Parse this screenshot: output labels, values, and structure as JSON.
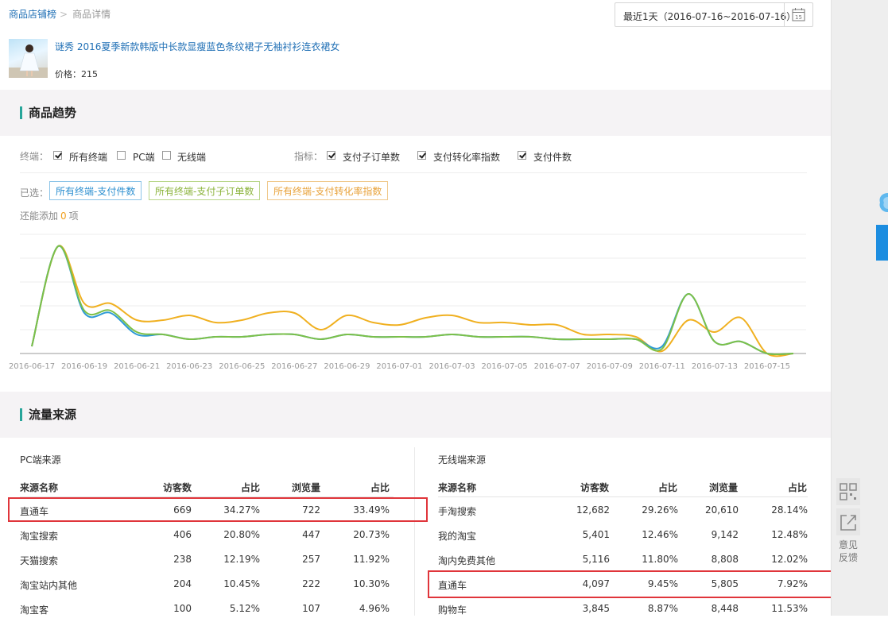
{
  "breadcrumb": {
    "root": "商品店铺榜",
    "current": "商品详情"
  },
  "date_picker": {
    "label": "最近1天（2016-07-16~2016-07-16）",
    "calendar_day": "15"
  },
  "product": {
    "title": "谜秀 2016夏季新款韩版中长款显瘦蓝色条纹裙子无袖衬衫连衣裙女",
    "price_label": "价格：215"
  },
  "trend_section": {
    "title": "商品趋势",
    "terminal_label": "终端：",
    "terminals": [
      {
        "label": "所有终端",
        "checked": true
      },
      {
        "label": "PC端",
        "checked": false
      },
      {
        "label": "无线端",
        "checked": false
      }
    ],
    "metric_label": "指标：",
    "metrics": [
      {
        "label": "支付子订单数",
        "checked": true
      },
      {
        "label": "支付转化率指数",
        "checked": true
      },
      {
        "label": "支付件数",
        "checked": true
      }
    ],
    "selected_label": "已选：",
    "selected_tags": [
      {
        "label": "所有终端-支付件数",
        "color": "#2c8fd0",
        "border": "#8cc4e8"
      },
      {
        "label": "所有终端-支付子订单数",
        "color": "#8ab33a",
        "border": "#b9d68a"
      },
      {
        "label": "所有终端-支付转化率指数",
        "color": "#e8a23a",
        "border": "#f0c98c"
      }
    ],
    "more_prefix": "还能添加",
    "more_count": "0",
    "more_suffix": "项"
  },
  "chart_data": {
    "type": "line",
    "x": [
      "2016-06-17",
      "2016-06-18",
      "2016-06-19",
      "2016-06-20",
      "2016-06-21",
      "2016-06-22",
      "2016-06-23",
      "2016-06-24",
      "2016-06-25",
      "2016-06-26",
      "2016-06-27",
      "2016-06-28",
      "2016-06-29",
      "2016-06-30",
      "2016-07-01",
      "2016-07-02",
      "2016-07-03",
      "2016-07-04",
      "2016-07-05",
      "2016-07-06",
      "2016-07-07",
      "2016-07-08",
      "2016-07-09",
      "2016-07-10",
      "2016-07-11",
      "2016-07-12",
      "2016-07-13",
      "2016-07-14",
      "2016-07-15",
      "2016-07-16"
    ],
    "tick_labels": [
      "2016-06-17",
      "2016-06-19",
      "2016-06-21",
      "2016-06-23",
      "2016-06-25",
      "2016-06-27",
      "2016-06-29",
      "2016-07-01",
      "2016-07-03",
      "2016-07-05",
      "2016-07-07",
      "2016-07-09",
      "2016-07-11",
      "2016-07-13",
      "2016-07-15"
    ],
    "ylim": [
      0,
      5
    ],
    "grid": true,
    "series": [
      {
        "color": "#f0b020",
        "values": [
          0.3,
          4.5,
          2.1,
          2.1,
          1.4,
          1.4,
          1.6,
          1.3,
          1.4,
          1.7,
          1.7,
          1.0,
          1.6,
          1.3,
          1.2,
          1.5,
          1.6,
          1.3,
          1.3,
          1.2,
          1.2,
          0.8,
          0.8,
          0.7,
          0.1,
          1.4,
          0.9,
          1.5,
          0,
          0
        ]
      },
      {
        "color": "#2d9ad6",
        "values": [
          0.3,
          4.5,
          1.7,
          1.7,
          0.8,
          0.8,
          0.6,
          0.7,
          0.7,
          0.8,
          0.8,
          0.6,
          0.8,
          0.7,
          0.7,
          0.7,
          0.8,
          0.7,
          0.7,
          0.7,
          0.6,
          0.6,
          0.6,
          0.6,
          0.3,
          2.5,
          0.5,
          0.5,
          0,
          0
        ]
      },
      {
        "color": "#7cc048",
        "values": [
          0.3,
          4.5,
          1.8,
          1.8,
          0.9,
          0.8,
          0.6,
          0.7,
          0.7,
          0.8,
          0.8,
          0.6,
          0.8,
          0.7,
          0.7,
          0.7,
          0.8,
          0.7,
          0.7,
          0.7,
          0.6,
          0.6,
          0.6,
          0.6,
          0.2,
          2.5,
          0.5,
          0.5,
          0,
          0
        ]
      }
    ]
  },
  "traffic_section": {
    "title": "流量来源"
  },
  "pc_table": {
    "title": "PC端来源",
    "headers": [
      "来源名称",
      "访客数",
      "占比",
      "浏览量",
      "占比"
    ],
    "rows": [
      [
        "直通车",
        "669",
        "34.27%",
        "722",
        "33.49%"
      ],
      [
        "淘宝搜索",
        "406",
        "20.80%",
        "447",
        "20.73%"
      ],
      [
        "天猫搜索",
        "238",
        "12.19%",
        "257",
        "11.92%"
      ],
      [
        "淘宝站内其他",
        "204",
        "10.45%",
        "222",
        "10.30%"
      ],
      [
        "淘宝客",
        "100",
        "5.12%",
        "107",
        "4.96%"
      ]
    ]
  },
  "wireless_table": {
    "title": "无线端来源",
    "headers": [
      "来源名称",
      "访客数",
      "占比",
      "浏览量",
      "占比"
    ],
    "rows": [
      [
        "手淘搜索",
        "12,682",
        "29.26%",
        "20,610",
        "28.14%"
      ],
      [
        "我的淘宝",
        "5,401",
        "12.46%",
        "9,142",
        "12.48%"
      ],
      [
        "淘内免费其他",
        "5,116",
        "11.80%",
        "8,808",
        "12.02%"
      ],
      [
        "直通车",
        "4,097",
        "9.45%",
        "5,805",
        "7.92%"
      ],
      [
        "购物车",
        "3,845",
        "8.87%",
        "8,448",
        "11.53%"
      ]
    ]
  },
  "sidebar": {
    "feedback_line1": "意见",
    "feedback_line2": "反馈"
  }
}
